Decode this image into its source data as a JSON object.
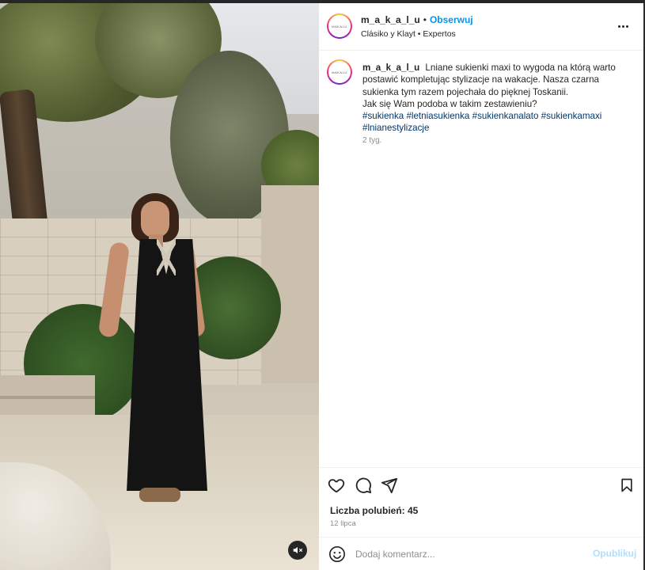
{
  "post": {
    "username": "m_a_k_a_l_u",
    "separator": "•",
    "follow_label": "Obserwuj",
    "audio_line": "Clásiko y Klayt • Expertos",
    "avatar_text": "MAKALU",
    "caption_text": "Lniane sukienki maxi to wygoda na którą warto postawić kompletując stylizacje na wakacje. Nasza czarna sukienka tym razem pojechała do pięknej Toskanii.",
    "caption_question": "Jak się Wam podoba w takim zestawieniu?",
    "hashtags": [
      "#sukienka",
      "#letniasukienka",
      "#sukienkanalato",
      "#sukienkamaxi",
      "#lnianestylizacje"
    ],
    "time_ago": "2 tyg.",
    "likes_label": "Liczba polubień: 45",
    "date": "12 lipca"
  },
  "comment_box": {
    "placeholder": "Dodaj komentarz...",
    "publish_label": "Opublikuj"
  },
  "icons": {
    "like": "heart-icon",
    "comment": "comment-icon",
    "share": "share-icon",
    "save": "bookmark-icon",
    "emoji": "emoji-icon",
    "mute": "muted-speaker-icon",
    "more": "more-options-icon"
  },
  "colors": {
    "accent": "#0095f6",
    "hashtag": "#00376b",
    "muted": "#8e8e8e",
    "publish_disabled": "#b2dffc"
  }
}
